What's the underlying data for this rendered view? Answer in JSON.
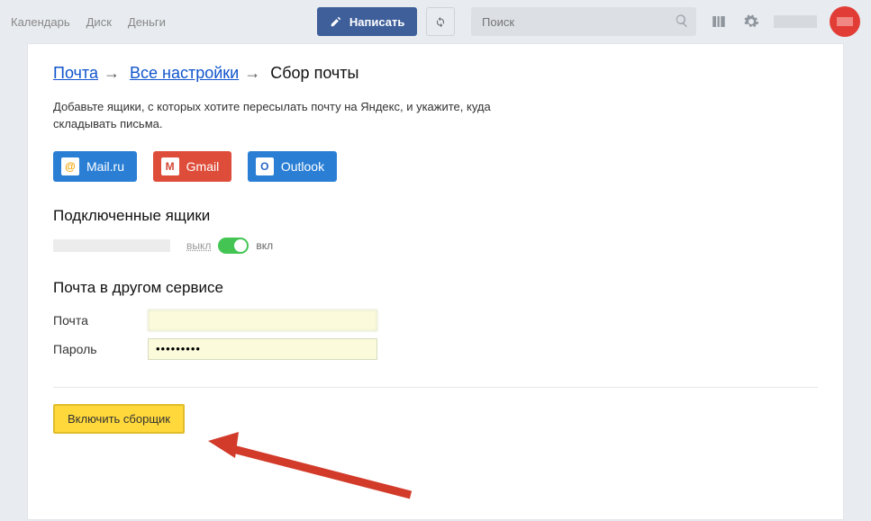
{
  "topnav": {
    "calendar": "Календарь",
    "disk": "Диск",
    "money": "Деньги"
  },
  "compose": "Написать",
  "search": {
    "placeholder": "Поиск"
  },
  "breadcrumb": {
    "mail": "Почта",
    "settings": "Все настройки",
    "current": "Сбор почты"
  },
  "intro": "Добавьте ящики, с которых хотите пересылать почту на Яндекс, и укажите, куда складывать письма.",
  "providers": {
    "mailru": "Mail.ru",
    "gmail": "Gmail",
    "outlook": "Outlook"
  },
  "connected": {
    "heading": "Подключенные ящики",
    "off": "выкл",
    "on": "вкл"
  },
  "other": {
    "heading": "Почта в другом сервисе",
    "email_label": "Почта",
    "password_label": "Пароль",
    "password_value": "•••••••••"
  },
  "submit": "Включить сборщик"
}
